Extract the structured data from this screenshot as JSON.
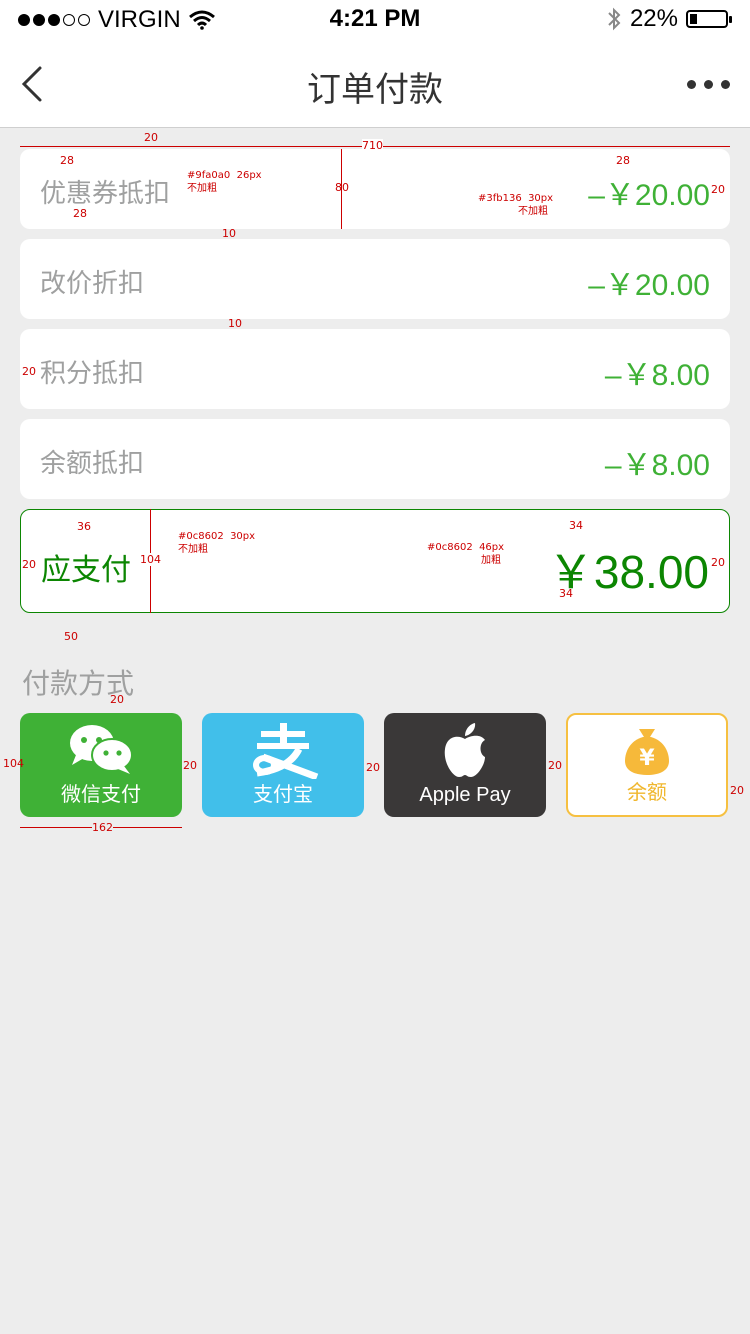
{
  "status_bar": {
    "carrier": "VIRGIN",
    "time": "4:21 PM",
    "battery": "22%",
    "battery_level": 0.22
  },
  "nav": {
    "title": "订单付款"
  },
  "discounts": [
    {
      "label": "优惠券抵扣",
      "amount": "–￥20.00"
    },
    {
      "label": "改价折扣",
      "amount": "–￥20.00"
    },
    {
      "label": "积分抵扣",
      "amount": "–￥8.00"
    },
    {
      "label": "余额抵扣",
      "amount": "–￥8.00"
    }
  ],
  "payable": {
    "label": "应支付",
    "amount": "￥38.00"
  },
  "payment_section": {
    "title": "付款方式",
    "methods": [
      {
        "name": "微信支付",
        "icon": "wechat-icon"
      },
      {
        "name": "支付宝",
        "icon": "alipay-icon"
      },
      {
        "name": "Apple Pay",
        "icon": "apple-icon"
      },
      {
        "name": "余额",
        "icon": "money-bag-icon"
      }
    ]
  },
  "annotations": {
    "w710": "710",
    "d20a": "20",
    "d28a": "28",
    "d28b": "28",
    "d28c": "28",
    "d80": "80",
    "d10a": "10",
    "d10b": "10",
    "d20b": "20",
    "d20c": "20",
    "d20d": "20",
    "d20e": "20",
    "d36": "36",
    "d104a": "104",
    "d34a": "34",
    "d34b": "34",
    "d50": "50",
    "d20f": "20",
    "d104b": "104",
    "d162": "162",
    "g1": "20",
    "g2": "20",
    "g3": "20",
    "g4": "20",
    "spec1_color": "#9fa0a0",
    "spec1_size": "26px",
    "spec1_weight": "不加粗",
    "spec2_color": "#3fb136",
    "spec2_size": "30px",
    "spec2_weight": "不加粗",
    "spec3_color": "#0c8602",
    "spec3_size": "30px",
    "spec3_weight": "不加粗",
    "spec4_color": "#0c8602",
    "spec4_size": "46px",
    "spec4_weight": "加粗"
  }
}
